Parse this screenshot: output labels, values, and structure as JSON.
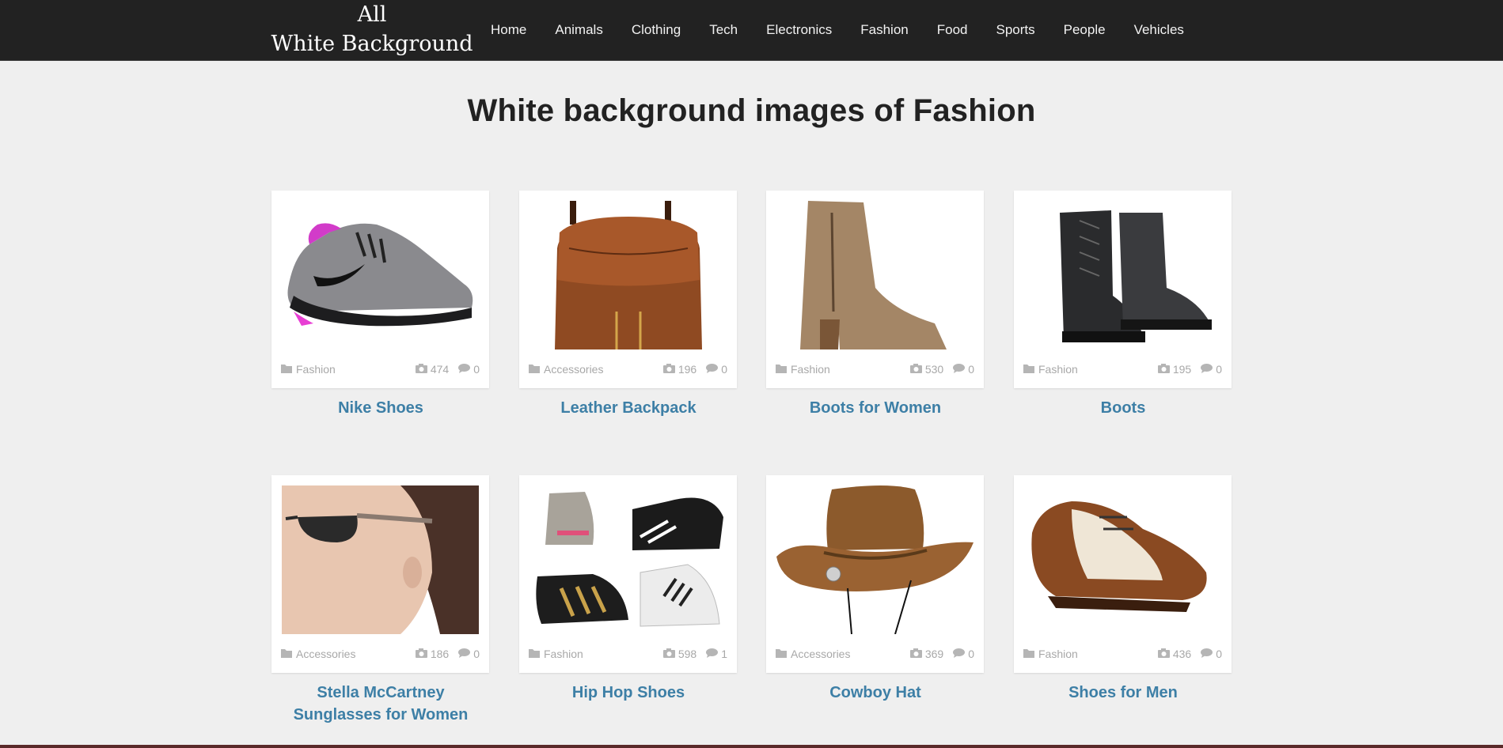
{
  "site": {
    "logo_line1": "All",
    "logo_line2": "White Background"
  },
  "nav": [
    "Home",
    "Animals",
    "Clothing",
    "Tech",
    "Electronics",
    "Fashion",
    "Food",
    "Sports",
    "People",
    "Vehicles"
  ],
  "page_title": "White background images of Fashion",
  "items": [
    {
      "title": "Nike Shoes",
      "category": "Fashion",
      "photos": "474",
      "comments": "0",
      "image": "sneaker"
    },
    {
      "title": "Leather Backpack",
      "category": "Accessories",
      "photos": "196",
      "comments": "0",
      "image": "backpack"
    },
    {
      "title": "Boots for Women",
      "category": "Fashion",
      "photos": "530",
      "comments": "0",
      "image": "ankle-boot"
    },
    {
      "title": "Boots",
      "category": "Fashion",
      "photos": "195",
      "comments": "0",
      "image": "combat-boots"
    },
    {
      "title": "Stella McCartney Sunglasses for Women",
      "title_line1": "Stella McCartney",
      "title_line2": "Sunglasses for Women",
      "category": "Accessories",
      "photos": "186",
      "comments": "0",
      "image": "sunglasses-woman"
    },
    {
      "title": "Hip Hop Shoes",
      "category": "Fashion",
      "photos": "598",
      "comments": "1",
      "image": "hiphop-shoes"
    },
    {
      "title": "Cowboy Hat",
      "category": "Accessories",
      "photos": "369",
      "comments": "0",
      "image": "cowboy-hat"
    },
    {
      "title": "Shoes for Men",
      "category": "Fashion",
      "photos": "436",
      "comments": "0",
      "image": "oxford-shoe"
    }
  ],
  "icons": {
    "category": "folder-icon",
    "photos": "camera-icon",
    "comments": "comment-icon"
  },
  "colors": {
    "navbar": "#222222",
    "background": "#efefef",
    "link": "#3d7fa6",
    "meta": "#a8a8a8"
  }
}
